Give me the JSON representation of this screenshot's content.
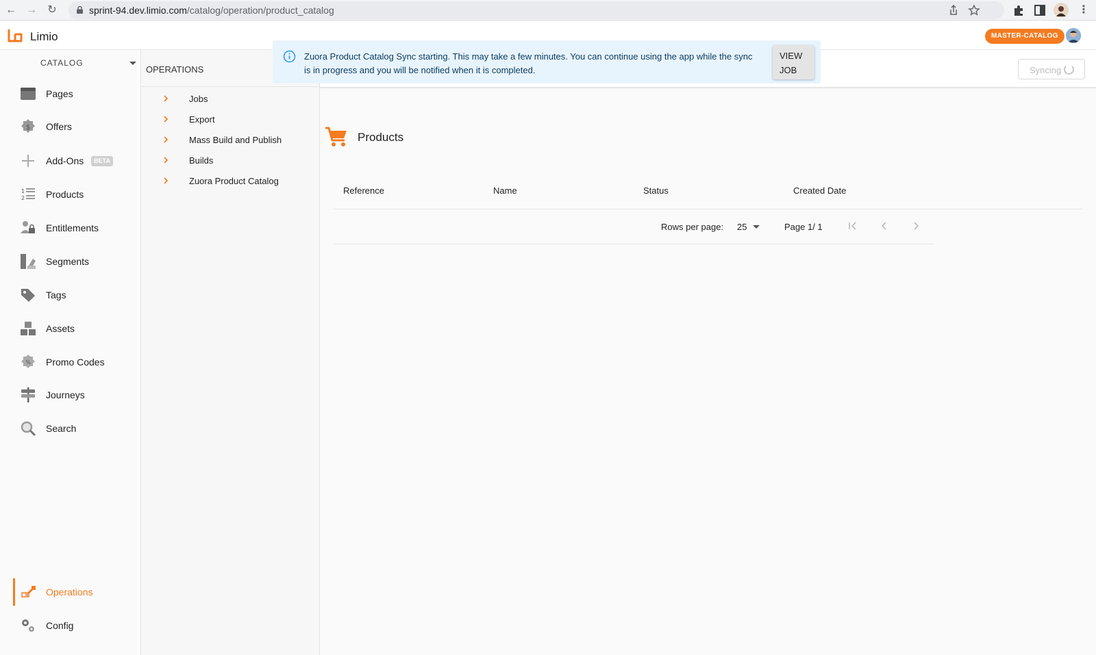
{
  "browser": {
    "url_host": "sprint-94.dev.limio.com",
    "url_path": "/catalog/operation/product_catalog"
  },
  "app": {
    "logo_text": "Limio",
    "catalog_badge": "MASTER-CATALOG",
    "accent": "#f47b20"
  },
  "sidebar": {
    "header": "CATALOG",
    "items": [
      {
        "label": "Pages",
        "icon": "pages-icon"
      },
      {
        "label": "Offers",
        "icon": "offers-icon"
      },
      {
        "label": "Add-Ons",
        "icon": "add-icon",
        "badge": "BETA"
      },
      {
        "label": "Products",
        "icon": "list-icon"
      },
      {
        "label": "Entitlements",
        "icon": "entitlements-icon"
      },
      {
        "label": "Segments",
        "icon": "segments-icon"
      },
      {
        "label": "Tags",
        "icon": "tag-icon"
      },
      {
        "label": "Assets",
        "icon": "assets-icon"
      },
      {
        "label": "Promo Codes",
        "icon": "promo-icon"
      },
      {
        "label": "Journeys",
        "icon": "journeys-icon"
      },
      {
        "label": "Search",
        "icon": "search-icon"
      }
    ],
    "bottom": [
      {
        "label": "Operations",
        "icon": "operations-icon",
        "active": true
      },
      {
        "label": "Config",
        "icon": "gear-icon"
      }
    ]
  },
  "operations": {
    "header": "OPERATIONS",
    "items": [
      "Jobs",
      "Export",
      "Mass Build and Publish",
      "Builds",
      "Zuora Product Catalog"
    ]
  },
  "toast": {
    "message": "Zuora Product Catalog Sync starting. This may take a few minutes. You can continue using the app while the sync is in progress and you will be notified when it is completed.",
    "action_line1": "VIEW",
    "action_line2": "JOB"
  },
  "main": {
    "sync_label": "Syncing",
    "title": "Products",
    "columns": [
      "Reference",
      "Name",
      "Status",
      "Created Date"
    ],
    "pagination": {
      "rows_label": "Rows per page:",
      "rows_value": "25",
      "page_label": "Page 1/ 1"
    }
  }
}
